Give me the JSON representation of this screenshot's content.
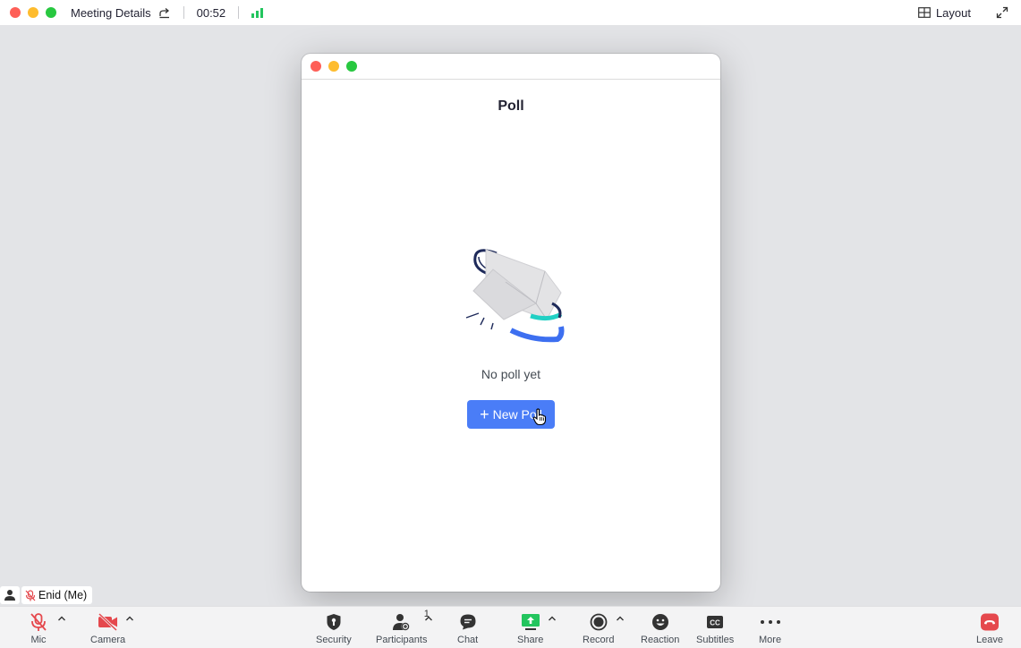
{
  "topbar": {
    "meeting_title": "Meeting Details",
    "timer": "00:52",
    "layout_label": "Layout"
  },
  "poll": {
    "heading": "Poll",
    "empty_text": "No poll yet",
    "new_poll_label": "New Poll"
  },
  "self": {
    "name": "Enid (Me)"
  },
  "toolbar": {
    "mic": "Mic",
    "camera": "Camera",
    "security": "Security",
    "participants": "Participants",
    "participants_count": "1",
    "chat": "Chat",
    "share": "Share",
    "record": "Record",
    "reaction": "Reaction",
    "subtitles": "Subtitles",
    "more": "More",
    "leave": "Leave"
  },
  "colors": {
    "accent": "#4a7df7",
    "muted_red": "#e5484d",
    "share_green": "#23c55e",
    "leave_red": "#e5484d"
  }
}
